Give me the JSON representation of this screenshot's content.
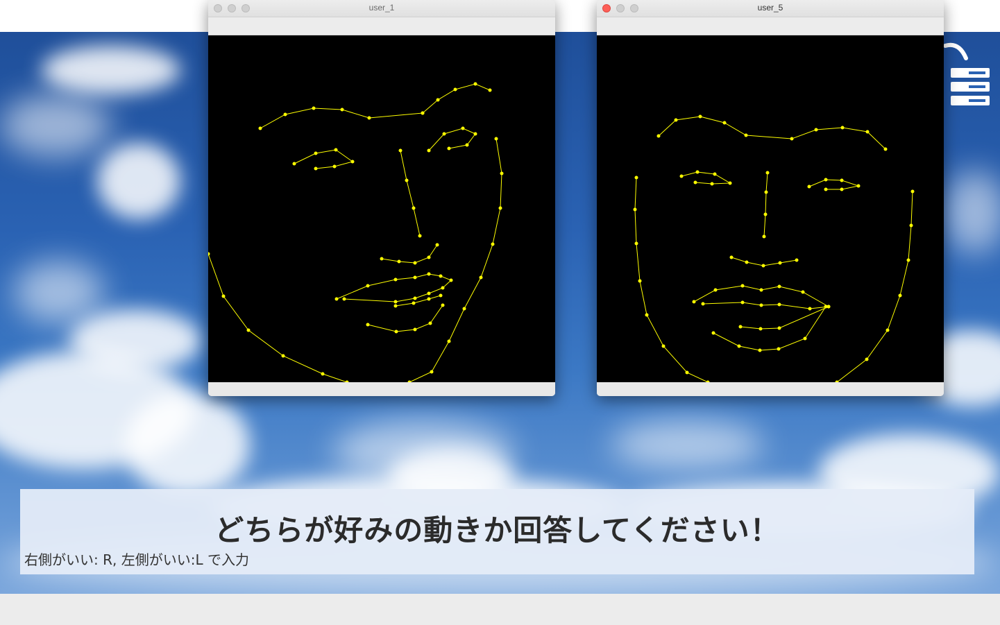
{
  "windows": [
    {
      "title": "user_1"
    },
    {
      "title": "user_5"
    }
  ],
  "prompt": {
    "title": "どちらが好みの動きか回答してください！",
    "instruction": "右側がいい: R, 左側がいい:L で入力"
  },
  "colors": {
    "landmark": "#ffff00",
    "canvas": "#000000",
    "close_button": "#fd5f57"
  }
}
